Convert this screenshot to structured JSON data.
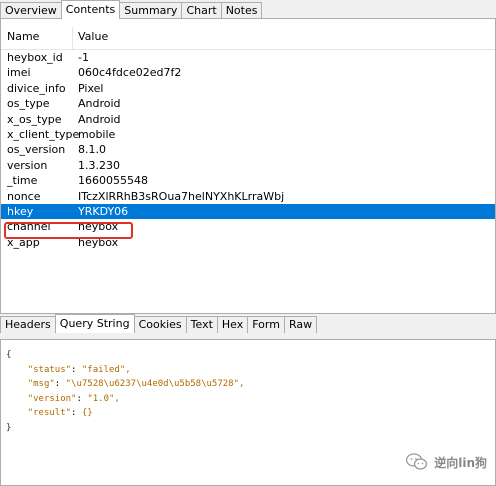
{
  "top_tabs": [
    "Overview",
    "Contents",
    "Summary",
    "Chart",
    "Notes"
  ],
  "grid": {
    "columns": [
      "Name",
      "Value"
    ],
    "rows": [
      {
        "name": "heybox_id",
        "value": "-1"
      },
      {
        "name": "imei",
        "value": "060c4fdce02ed7f2"
      },
      {
        "name": "divice_info",
        "value": "Pixel"
      },
      {
        "name": "os_type",
        "value": "Android"
      },
      {
        "name": "x_os_type",
        "value": "Android"
      },
      {
        "name": "x_client_type",
        "value": "mobile"
      },
      {
        "name": "os_version",
        "value": "8.1.0"
      },
      {
        "name": "version",
        "value": "1.3.230"
      },
      {
        "name": "_time",
        "value": "1660055548"
      },
      {
        "name": "nonce",
        "value": "ITczXlRRhB3sROua7helNYXhKLrraWbj"
      },
      {
        "name": "hkey",
        "value": "YRKDY06"
      },
      {
        "name": "channel",
        "value": "heybox"
      },
      {
        "name": "x_app",
        "value": "heybox"
      }
    ],
    "selected_row": "hkey"
  },
  "bottom_tabs": [
    "Headers",
    "Query String",
    "Cookies",
    "Text",
    "Hex",
    "Form",
    "Raw"
  ],
  "response": {
    "open_brace": "{",
    "lines": [
      {
        "key": "\"status\"",
        "value": "\"failed\","
      },
      {
        "key": "\"msg\"",
        "value": "\"\\u7528\\u6237\\u4e0d\\u5b58\\u5728\","
      },
      {
        "key": "\"version\"",
        "value": "\"1.0\","
      },
      {
        "key": "\"result\"",
        "value": "{}"
      }
    ],
    "close_brace": "}"
  },
  "watermark": "逆向lin狗",
  "colors": {
    "selection": "#0078d7",
    "highlight_border": "#e0302a"
  }
}
